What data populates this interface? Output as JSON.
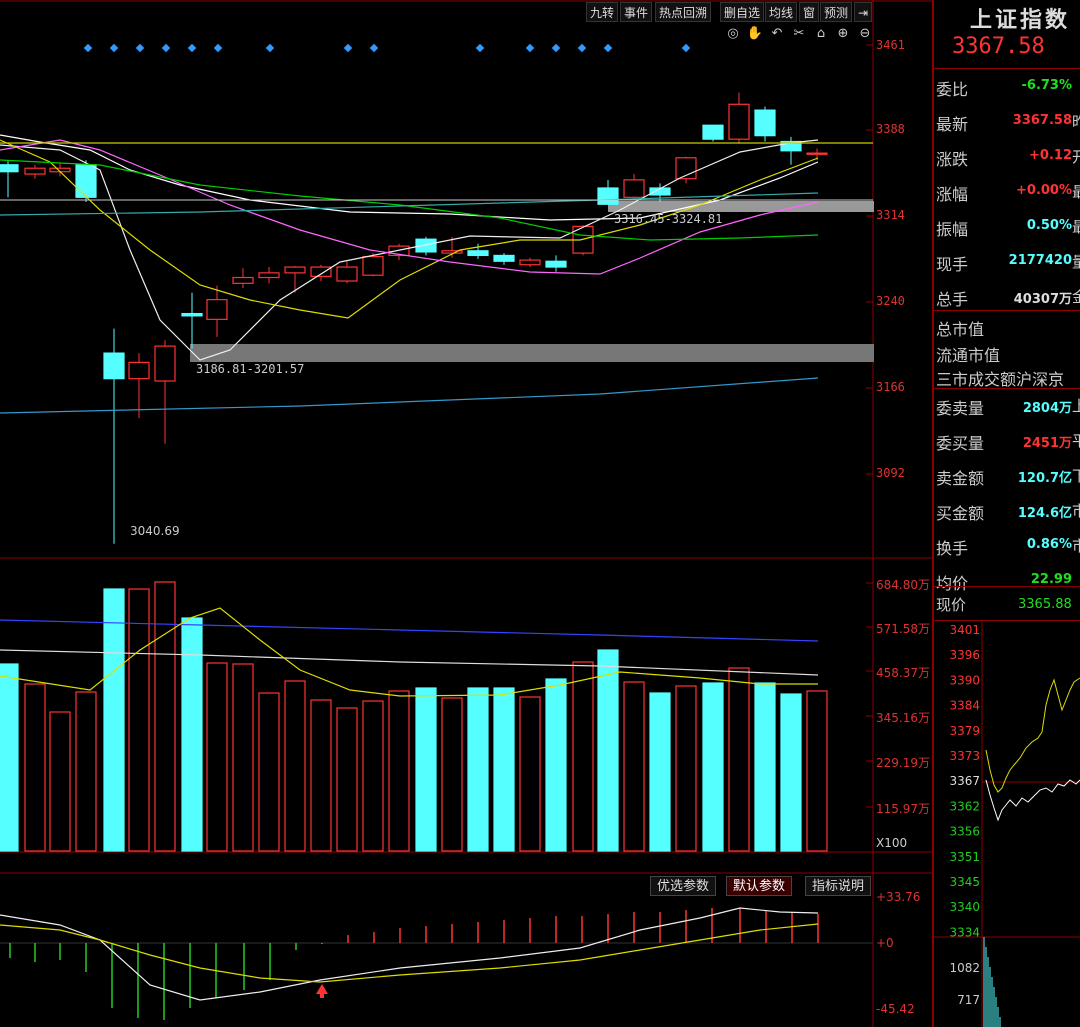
{
  "toolbar": {
    "buttons": [
      "九转",
      "事件",
      "热点回溯",
      "删自选",
      "均线",
      "窗",
      "预测"
    ],
    "collapse_icon": "collapse-right-icon",
    "tools": [
      "eye-icon",
      "hand-icon",
      "undo-icon",
      "scissors-icon",
      "lock-icon",
      "zoom-in-icon",
      "zoom-out-icon"
    ]
  },
  "kline": {
    "y_ticks": [
      "3461",
      "3388",
      "3314",
      "3240",
      "3166",
      "3092"
    ],
    "annotations": {
      "low_label": "3040.69",
      "gap1": "3186.81-3201.57",
      "gap2": "3316.45-3324.81"
    },
    "colors": {
      "up": "#ff3333",
      "down": "#55ffff",
      "ma5": "#ffffff",
      "ma10": "#dddd00",
      "ma20": "#ff66ff",
      "ma60": "#00cc00",
      "long": "#3399ff"
    }
  },
  "volume": {
    "y_ticks": [
      "684.80万",
      "571.58万",
      "458.37万",
      "345.16万",
      "229.19万",
      "115.97万"
    ],
    "unit": "X100"
  },
  "macd": {
    "y_ticks": [
      "+33.76",
      "+0",
      "-45.42"
    ],
    "param_buttons": [
      "优选参数",
      "默认参数",
      "指标说明"
    ]
  },
  "quote": {
    "title": "上证指数",
    "title_tail": "(",
    "price": "3367.58",
    "rows": [
      {
        "label": "委比",
        "value": "-6.73%",
        "color": "#22dd22",
        "tail": ""
      },
      {
        "label": "最新",
        "value": "3367.58",
        "color": "#ff3333",
        "tail": "昨"
      },
      {
        "label": "涨跌",
        "value": "+0.12",
        "color": "#ff3333",
        "tail": "开"
      },
      {
        "label": "涨幅",
        "value": "+0.00%",
        "color": "#ff3333",
        "tail": "最"
      },
      {
        "label": "振幅",
        "value": "0.50%",
        "color": "#55ffff",
        "tail": "最"
      },
      {
        "label": "现手",
        "value": "2177420",
        "color": "#55ffff",
        "tail": "量"
      },
      {
        "label": "总手",
        "value": "40307万",
        "color": "#dddddd",
        "tail": "金"
      }
    ],
    "market_labels": [
      "总市值",
      "流通市值",
      "三市成交额沪深京"
    ],
    "rows2": [
      {
        "label": "委卖量",
        "value": "2804万",
        "color": "#55ffff",
        "tail": "上"
      },
      {
        "label": "委买量",
        "value": "2451万",
        "color": "#ff3333",
        "tail": "平"
      },
      {
        "label": "卖金额",
        "value": "120.7亿",
        "color": "#55ffff",
        "tail": "下"
      },
      {
        "label": "买金额",
        "value": "124.6亿",
        "color": "#55ffff",
        "tail": "市"
      },
      {
        "label": "换手",
        "value": "0.86%",
        "color": "#55ffff",
        "tail": "市"
      },
      {
        "label": "均价",
        "value": "22.99",
        "color": "#22dd22",
        "tail": ""
      }
    ],
    "now_label": "现价",
    "now_value": "3365.88"
  },
  "intraday": {
    "y_ticks": [
      "3401",
      "3396",
      "3390",
      "3384",
      "3379",
      "3373",
      "3367",
      "3362",
      "3356",
      "3351",
      "3345",
      "3340",
      "3334"
    ],
    "vol_ticks": [
      "1082",
      "717"
    ]
  }
}
